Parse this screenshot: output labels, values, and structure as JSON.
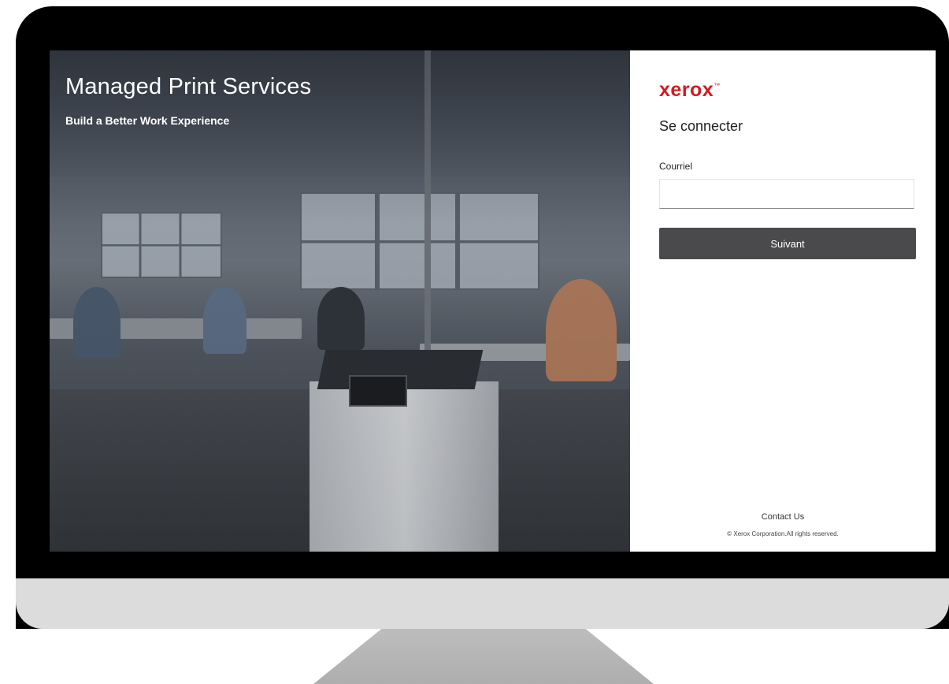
{
  "hero": {
    "title": "Managed Print Services",
    "subtitle": "Build a Better Work Experience"
  },
  "login": {
    "logo_text": "xerox",
    "logo_mark": "™",
    "heading": "Se connecter",
    "email_label": "Courriel",
    "email_value": "",
    "email_placeholder": "",
    "next_button": "Suivant"
  },
  "footer": {
    "contact": "Contact Us",
    "copyright": "© Xerox Corporation.All rights reserved."
  },
  "colors": {
    "brand_red": "#d71920",
    "button_bg": "#4a4a4c"
  }
}
